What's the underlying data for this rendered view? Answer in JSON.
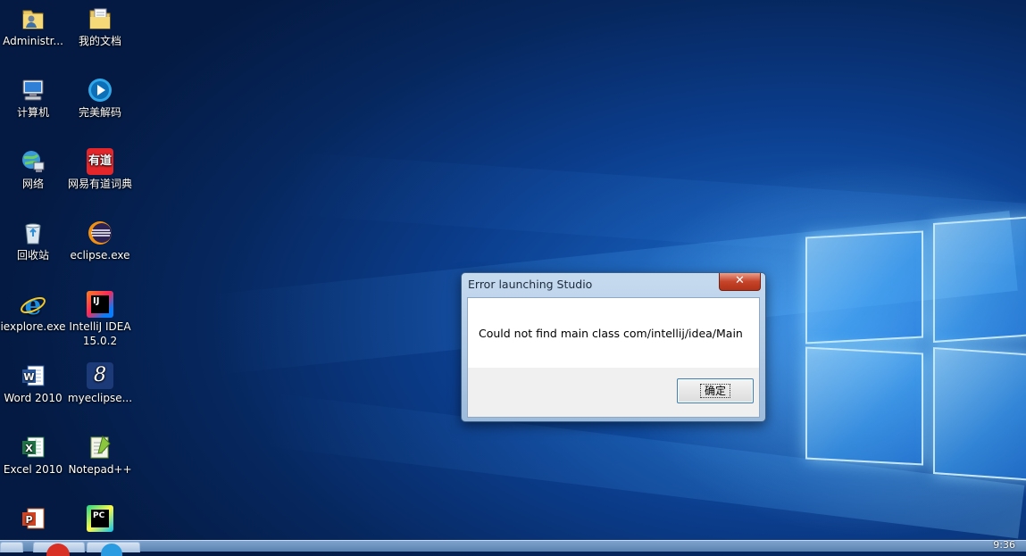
{
  "desktop": {
    "icons": [
      {
        "label": "Administr...",
        "icon": "user-folder-icon"
      },
      {
        "label": "我的文档",
        "icon": "documents-folder-icon"
      },
      {
        "label": "计算机",
        "icon": "computer-icon"
      },
      {
        "label": "完美解码",
        "icon": "media-player-icon"
      },
      {
        "label": "网络",
        "icon": "network-icon"
      },
      {
        "label": "网易有道词典",
        "icon": "youdao-dict-icon"
      },
      {
        "label": "回收站",
        "icon": "recycle-bin-icon"
      },
      {
        "label": "eclipse.exe",
        "icon": "eclipse-icon"
      },
      {
        "label": "iexplore.exe",
        "icon": "internet-explorer-icon"
      },
      {
        "label": "IntelliJ IDEA 15.0.2",
        "icon": "intellij-icon"
      },
      {
        "label": "Word 2010",
        "icon": "word-icon"
      },
      {
        "label": "myeclipse...",
        "icon": "myeclipse-icon"
      },
      {
        "label": "Excel 2010",
        "icon": "excel-icon"
      },
      {
        "label": "Notepad++",
        "icon": "notepadpp-icon"
      },
      {
        "label": "",
        "icon": "powerpoint-icon"
      },
      {
        "label": "",
        "icon": "pycharm-icon"
      }
    ],
    "youdao_badge": "有道",
    "intellij_badge": "IJ",
    "myeclipse_glyph": "8",
    "pycharm_badge": "PC"
  },
  "dialog": {
    "title": "Error launching Studio",
    "close_glyph": "✕",
    "message": "Could not find main class com/intellij/idea/Main",
    "ok_label": "确定"
  },
  "taskbar": {
    "clock": "9:36"
  },
  "colors": {
    "dialog_frame": "#9dbbdc",
    "close_button": "#c5442a",
    "desktop_bg": "#0b3d8c"
  }
}
